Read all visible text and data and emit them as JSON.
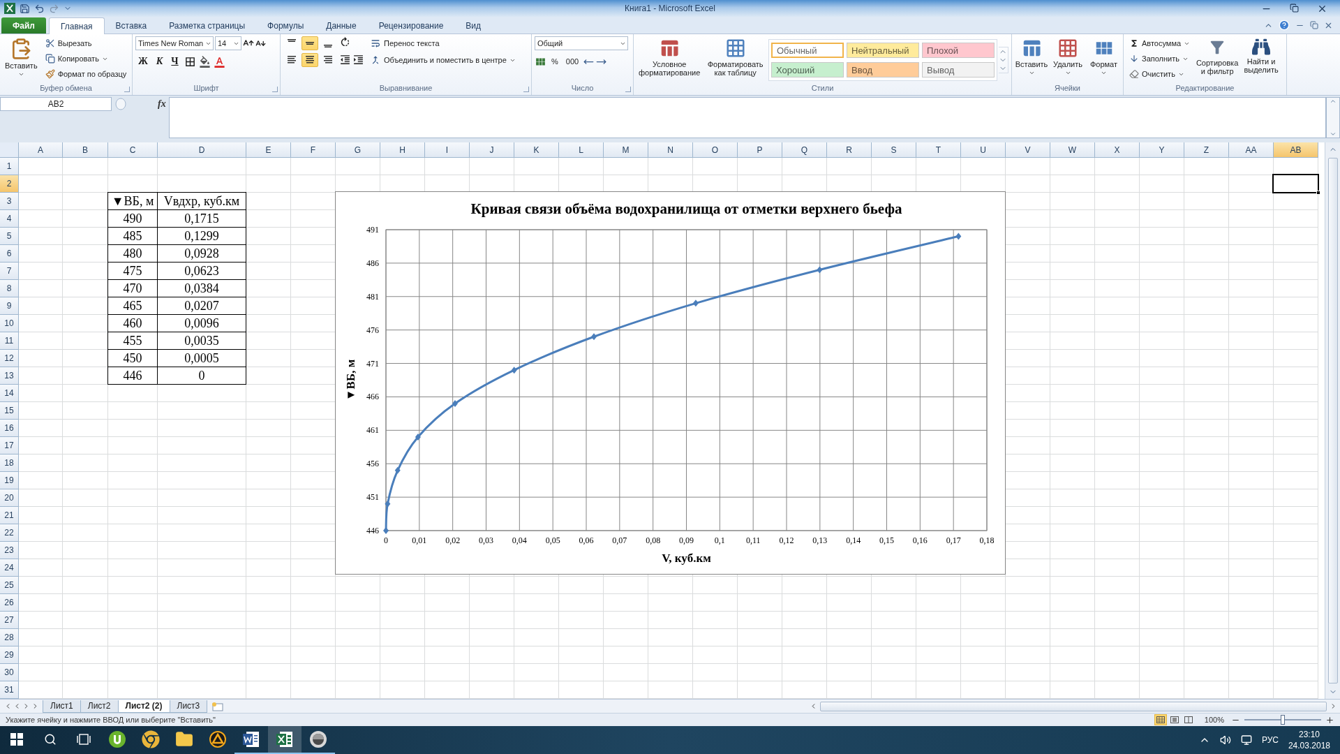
{
  "window": {
    "title": "Книга1 - Microsoft Excel"
  },
  "ribbon_tabs": [
    {
      "label": "Файл",
      "kind": "file",
      "selected": false
    },
    {
      "label": "Главная",
      "kind": "tab",
      "selected": true
    },
    {
      "label": "Вставка",
      "kind": "tab",
      "selected": false
    },
    {
      "label": "Разметка страницы",
      "kind": "tab",
      "selected": false
    },
    {
      "label": "Формулы",
      "kind": "tab",
      "selected": false
    },
    {
      "label": "Данные",
      "kind": "tab",
      "selected": false
    },
    {
      "label": "Рецензирование",
      "kind": "tab",
      "selected": false
    },
    {
      "label": "Вид",
      "kind": "tab",
      "selected": false
    }
  ],
  "clipboard": {
    "paste": "Вставить",
    "cut": "Вырезать",
    "copy": "Копировать",
    "format_painter": "Формат по образцу",
    "group": "Буфер обмена"
  },
  "font": {
    "name": "Times New Roman",
    "size": "14",
    "bold": "Ж",
    "italic": "К",
    "underline": "Ч",
    "group": "Шрифт"
  },
  "alignment": {
    "vertical": [
      {
        "selected": false
      },
      {
        "selected": true
      },
      {
        "selected": false
      }
    ],
    "horizontal": [
      {
        "selected": false
      },
      {
        "selected": true
      },
      {
        "selected": false
      }
    ],
    "wrap": "Перенос текста",
    "merge": "Объединить и поместить в центре",
    "group": "Выравнивание"
  },
  "number": {
    "format": "Общий",
    "percent": "%",
    "thousands": "000",
    "group": "Число"
  },
  "styles": {
    "conditional": "Условное форматирование",
    "as_table": "Форматировать как таблицу",
    "group": "Стили",
    "cells": [
      {
        "label": "Обычный",
        "color": "#ffffff",
        "selected": true
      },
      {
        "label": "Нейтральный",
        "color": "#ffeb9c",
        "selected": false
      },
      {
        "label": "Плохой",
        "color": "#ffc7ce",
        "selected": false
      },
      {
        "label": "Хороший",
        "color": "#c6efce",
        "selected": false
      },
      {
        "label": "Ввод",
        "color": "#ffcc99",
        "selected": false
      },
      {
        "label": "Вывод",
        "color": "#f2f2f2",
        "selected": false
      }
    ]
  },
  "cells_group": {
    "insert": "Вставить",
    "delete": "Удалить",
    "format": "Формат",
    "group": "Ячейки"
  },
  "editing": {
    "autosum": "Автосумма",
    "fill": "Заполнить",
    "clear": "Очистить",
    "sort": "Сортировка и фильтр",
    "find": "Найти и выделить",
    "group": "Редактирование"
  },
  "formula_bar": {
    "name_box": "AB2",
    "fx": "fx"
  },
  "sheet": {
    "columns": [
      {
        "label": "A",
        "selected": false
      },
      {
        "label": "B",
        "selected": false
      },
      {
        "label": "C",
        "selected": false
      },
      {
        "label": "D",
        "selected": false
      },
      {
        "label": "E",
        "selected": false
      },
      {
        "label": "F",
        "selected": false
      },
      {
        "label": "G",
        "selected": false
      },
      {
        "label": "H",
        "selected": false
      },
      {
        "label": "I",
        "selected": false
      },
      {
        "label": "J",
        "selected": false
      },
      {
        "label": "K",
        "selected": false
      },
      {
        "label": "L",
        "selected": false
      },
      {
        "label": "M",
        "selected": false
      },
      {
        "label": "N",
        "selected": false
      },
      {
        "label": "O",
        "selected": false
      },
      {
        "label": "P",
        "selected": false
      },
      {
        "label": "Q",
        "selected": false
      },
      {
        "label": "R",
        "selected": false
      },
      {
        "label": "S",
        "selected": false
      },
      {
        "label": "T",
        "selected": false
      },
      {
        "label": "U",
        "selected": false
      },
      {
        "label": "V",
        "selected": false
      },
      {
        "label": "W",
        "selected": false
      },
      {
        "label": "X",
        "selected": false
      },
      {
        "label": "Y",
        "selected": false
      },
      {
        "label": "Z",
        "selected": false
      },
      {
        "label": "AA",
        "selected": false
      },
      {
        "label": "AB",
        "selected": true
      }
    ],
    "rows": [
      {
        "label": "1",
        "selected": false
      },
      {
        "label": "2",
        "selected": true
      },
      {
        "label": "3",
        "selected": false
      },
      {
        "label": "4",
        "selected": false
      },
      {
        "label": "5",
        "selected": false
      },
      {
        "label": "6",
        "selected": false
      },
      {
        "label": "7",
        "selected": false
      },
      {
        "label": "8",
        "selected": false
      },
      {
        "label": "9",
        "selected": false
      },
      {
        "label": "10",
        "selected": false
      },
      {
        "label": "11",
        "selected": false
      },
      {
        "label": "12",
        "selected": false
      },
      {
        "label": "13",
        "selected": false
      },
      {
        "label": "14",
        "selected": false
      },
      {
        "label": "15",
        "selected": false
      },
      {
        "label": "16",
        "selected": false
      },
      {
        "label": "17",
        "selected": false
      },
      {
        "label": "18",
        "selected": false
      },
      {
        "label": "19",
        "selected": false
      },
      {
        "label": "20",
        "selected": false
      },
      {
        "label": "21",
        "selected": false
      },
      {
        "label": "22",
        "selected": false
      },
      {
        "label": "23",
        "selected": false
      },
      {
        "label": "24",
        "selected": false
      },
      {
        "label": "25",
        "selected": false
      },
      {
        "label": "26",
        "selected": false
      },
      {
        "label": "27",
        "selected": false
      },
      {
        "label": "28",
        "selected": false
      },
      {
        "label": "29",
        "selected": false
      },
      {
        "label": "30",
        "selected": false
      },
      {
        "label": "31",
        "selected": false
      }
    ],
    "table": {
      "header": [
        "▼ВБ, м",
        "Vвдхр, куб.км"
      ],
      "rows": [
        [
          "490",
          "0,1715"
        ],
        [
          "485",
          "0,1299"
        ],
        [
          "480",
          "0,0928"
        ],
        [
          "475",
          "0,0623"
        ],
        [
          "470",
          "0,0384"
        ],
        [
          "465",
          "0,0207"
        ],
        [
          "460",
          "0,0096"
        ],
        [
          "455",
          "0,0035"
        ],
        [
          "450",
          "0,0005"
        ],
        [
          "446",
          "0"
        ]
      ]
    }
  },
  "chart": {
    "chart_data": {
      "type": "line",
      "title": "Кривая связи объёма водохранилища от отметки верхнего бьефа",
      "xlabel": "V, куб.км",
      "ylabel": "▼ВБ, м",
      "x": [
        0,
        0.0005,
        0.0035,
        0.0096,
        0.0207,
        0.0384,
        0.0623,
        0.0928,
        0.1299,
        0.1715
      ],
      "grid": true,
      "series": [
        {
          "color": "#4a7ebb",
          "marker": "diamond",
          "values": [
            446,
            450,
            455,
            460,
            465,
            470,
            475,
            480,
            485,
            490
          ]
        }
      ],
      "xlim": [
        0,
        0.18
      ],
      "ylim": [
        446,
        491
      ],
      "xticks": [
        {
          "value": 0,
          "label": "0"
        },
        {
          "value": 0.01,
          "label": "0,01"
        },
        {
          "value": 0.02,
          "label": "0,02"
        },
        {
          "value": 0.03,
          "label": "0,03"
        },
        {
          "value": 0.04,
          "label": "0,04"
        },
        {
          "value": 0.05,
          "label": "0,05"
        },
        {
          "value": 0.06,
          "label": "0,06"
        },
        {
          "value": 0.07,
          "label": "0,07"
        },
        {
          "value": 0.08,
          "label": "0,08"
        },
        {
          "value": 0.09,
          "label": "0,09"
        },
        {
          "value": 0.1,
          "label": "0,1"
        },
        {
          "value": 0.11,
          "label": "0,11"
        },
        {
          "value": 0.12,
          "label": "0,12"
        },
        {
          "value": 0.13,
          "label": "0,13"
        },
        {
          "value": 0.14,
          "label": "0,14"
        },
        {
          "value": 0.15,
          "label": "0,15"
        },
        {
          "value": 0.16,
          "label": "0,16"
        },
        {
          "value": 0.17,
          "label": "0,17"
        },
        {
          "value": 0.18,
          "label": "0,18"
        }
      ],
      "yticks": [
        446,
        451,
        456,
        461,
        466,
        471,
        476,
        481,
        486,
        491
      ]
    }
  },
  "sheet_tabs": [
    {
      "label": "Лист1",
      "selected": false
    },
    {
      "label": "Лист2",
      "selected": false
    },
    {
      "label": "Лист2 (2)",
      "selected": true
    },
    {
      "label": "Лист3",
      "selected": false
    }
  ],
  "status_bar": {
    "message": "Укажите ячейку и нажмите ВВОД или выберите \"Вставить\"",
    "views": [
      {
        "selected": true
      },
      {
        "selected": false
      },
      {
        "selected": false
      }
    ],
    "zoom": "100%",
    "zoom_slider": {
      "level": 0.5
    }
  },
  "taskbar": {
    "apps": [
      {
        "selected": false,
        "open": false
      },
      {
        "selected": false,
        "open": false
      },
      {
        "selected": false,
        "open": false
      },
      {
        "selected": false,
        "open": false
      },
      {
        "selected": false,
        "open": true
      },
      {
        "selected": true,
        "open": true
      },
      {
        "selected": false,
        "open": true
      }
    ],
    "language": "РУС",
    "time": "23:10",
    "date": "24.03.2018"
  }
}
